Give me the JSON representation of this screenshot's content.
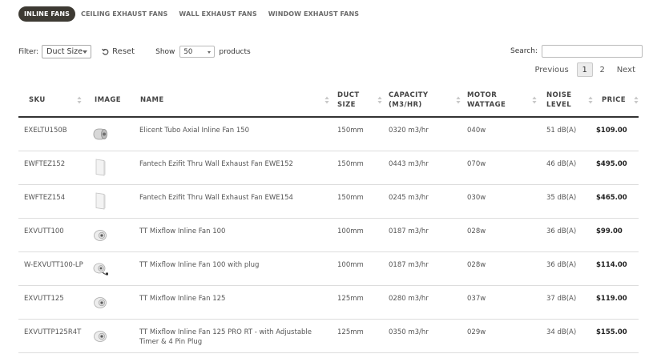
{
  "tabs": [
    {
      "label": "INLINE FANS",
      "active": true
    },
    {
      "label": "CEILING EXHAUST FANS",
      "active": false
    },
    {
      "label": "WALL EXHAUST FANS",
      "active": false
    },
    {
      "label": "WINDOW EXHAUST FANS",
      "active": false
    }
  ],
  "filter": {
    "label": "Filter:",
    "selected": "Duct Size"
  },
  "reset": {
    "label": "Reset",
    "icon": "reset-icon"
  },
  "show": {
    "label": "Show",
    "selected": "50",
    "suffix": "products"
  },
  "search": {
    "label": "Search:",
    "value": ""
  },
  "pagination": {
    "previous": "Previous",
    "pages": [
      "1",
      "2"
    ],
    "current": "1",
    "next": "Next"
  },
  "table": {
    "headers": [
      {
        "line1": "SKU",
        "line2": "",
        "sortable": true
      },
      {
        "line1": "IMAGE",
        "line2": "",
        "sortable": false
      },
      {
        "line1": "NAME",
        "line2": "",
        "sortable": true
      },
      {
        "line1": "DUCT",
        "line2": "SIZE",
        "sortable": true
      },
      {
        "line1": "CAPACITY",
        "line2": "(M3/HR)",
        "sortable": true
      },
      {
        "line1": "MOTOR",
        "line2": "WATTAGE",
        "sortable": true
      },
      {
        "line1": "NOISE",
        "line2": "LEVEL",
        "sortable": true
      },
      {
        "line1": "PRICE",
        "line2": "",
        "sortable": true
      }
    ],
    "rows": [
      {
        "sku": "EXELTU150B",
        "image": "tubular-fan-icon",
        "name": "Elicent Tubo Axial Inline Fan 150",
        "duct": "150mm",
        "capacity": "0320 m3/hr",
        "wattage": "040w",
        "noise": "51 dB(A)",
        "price": "$109.00"
      },
      {
        "sku": "EWFTEZ152",
        "image": "wall-fan-icon",
        "name": "Fantech Ezifit Thru Wall Exhaust Fan EWE152",
        "duct": "150mm",
        "capacity": "0443 m3/hr",
        "wattage": "070w",
        "noise": "46 dB(A)",
        "price": "$495.00"
      },
      {
        "sku": "EWFTEZ154",
        "image": "wall-fan-icon",
        "name": "Fantech Ezifit Thru Wall Exhaust Fan EWE154",
        "duct": "150mm",
        "capacity": "0245 m3/hr",
        "wattage": "030w",
        "noise": "35 dB(A)",
        "price": "$465.00"
      },
      {
        "sku": "EXVUTT100",
        "image": "mixflow-fan-icon",
        "name": "TT Mixflow Inline Fan 100",
        "duct": "100mm",
        "capacity": "0187 m3/hr",
        "wattage": "028w",
        "noise": "36 dB(A)",
        "price": "$99.00"
      },
      {
        "sku": "W-EXVUTT100-LP",
        "image": "mixflow-fan-plug-icon",
        "name": "TT Mixflow Inline Fan 100 with plug",
        "duct": "100mm",
        "capacity": "0187 m3/hr",
        "wattage": "028w",
        "noise": "36 dB(A)",
        "price": "$114.00"
      },
      {
        "sku": "EXVUTT125",
        "image": "mixflow-fan-icon",
        "name": "TT Mixflow Inline Fan 125",
        "duct": "125mm",
        "capacity": "0280 m3/hr",
        "wattage": "037w",
        "noise": "37 dB(A)",
        "price": "$119.00"
      },
      {
        "sku": "EXVUTTP125R4T",
        "image": "mixflow-fan-icon",
        "name": "TT Mixflow Inline Fan 125 PRO RT - with Adjustable Timer & 4 Pin Plug",
        "duct": "125mm",
        "capacity": "0350 m3/hr",
        "wattage": "029w",
        "noise": "34 dB(A)",
        "price": "$155.00"
      }
    ]
  }
}
